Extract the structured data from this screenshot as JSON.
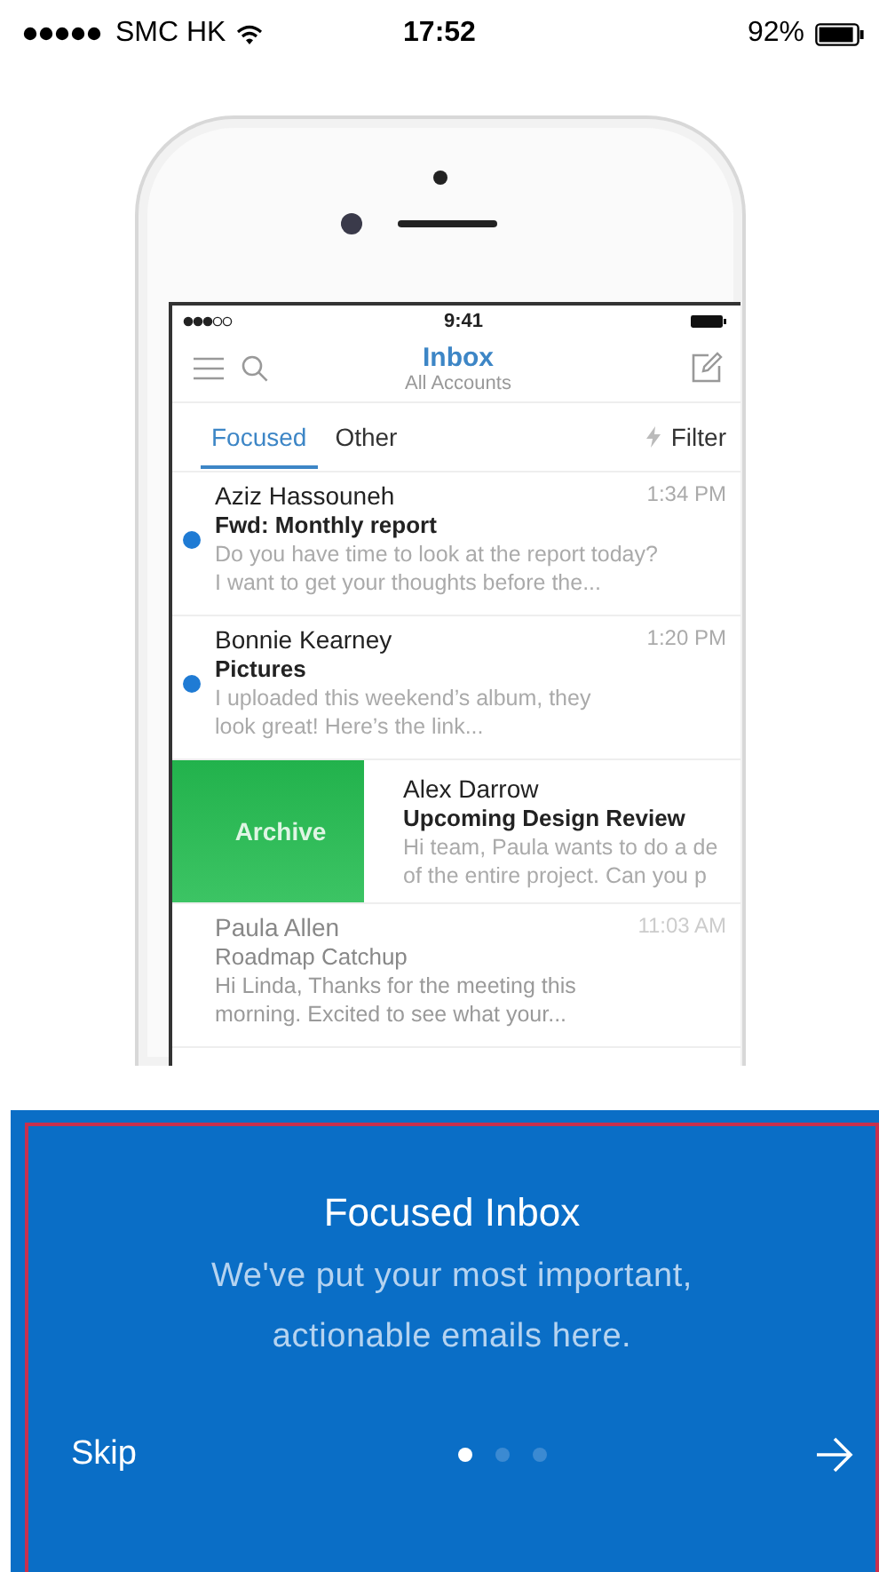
{
  "status_bar": {
    "carrier": "SMC HK",
    "time": "17:52",
    "battery": "92%"
  },
  "phone": {
    "status_bar": {
      "time": "9:41"
    },
    "header": {
      "title": "Inbox",
      "subtitle": "All Accounts"
    },
    "tabs": [
      {
        "label": "Focused",
        "selected": true
      },
      {
        "label": "Other",
        "selected": false
      }
    ],
    "filter": "Filter",
    "emails": [
      {
        "kind": "normal",
        "sender": "Aziz Hassouneh",
        "time": "1:34 PM",
        "subject": "Fwd: Monthly report",
        "preview": [
          "Do you have time to look at the report today?",
          "I want to get your thoughts before the..."
        ],
        "unread": true
      },
      {
        "kind": "normal",
        "sender": "Bonnie Kearney",
        "time": "1:20 PM",
        "subject": "Pictures",
        "preview": [
          "I uploaded this weekend’s album, they",
          "look great! Here’s the link..."
        ],
        "unread": true
      },
      {
        "kind": "swiped",
        "action": "Archive",
        "sender": "Alex Darrow",
        "subject": "Upcoming Design Review",
        "preview": [
          "Hi team, Paula wants to do a de",
          "of the entire project. Can you p"
        ]
      },
      {
        "kind": "normal",
        "sender": "Paula Allen",
        "time": "11:03 AM",
        "subject": "Roadmap Catchup",
        "preview": [
          "Hi Linda, Thanks for the meeting this",
          "morning. Excited to see what your..."
        ],
        "unread": false
      }
    ]
  },
  "onboarding": {
    "title": "Focused Inbox",
    "body": "We've put your most important, actionable emails here.",
    "skip": "Skip",
    "pages": [
      {
        "selected": true
      },
      {
        "selected": false
      },
      {
        "selected": false
      }
    ]
  }
}
